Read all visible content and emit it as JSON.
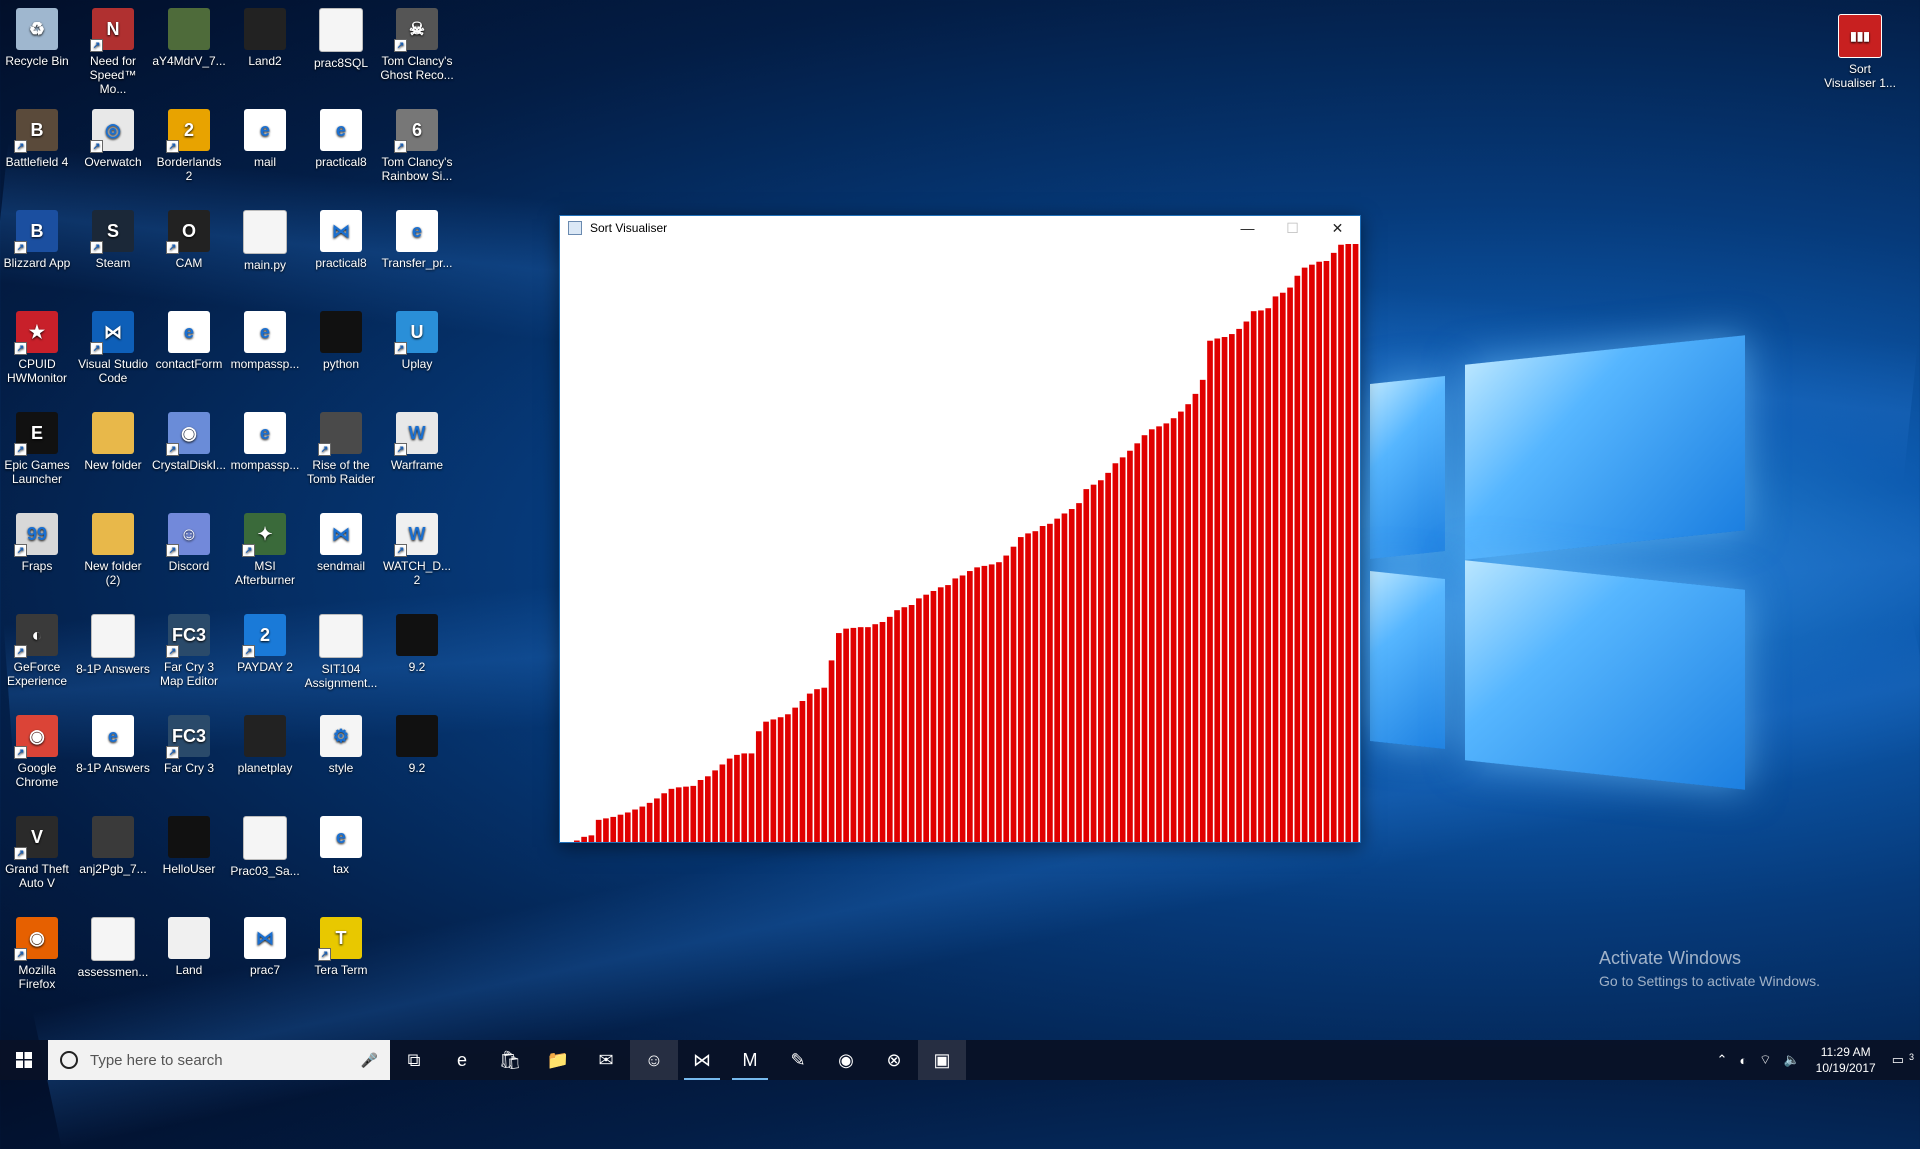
{
  "desktop": {
    "icons": [
      {
        "label": "Recycle Bin",
        "icon": "recycle-bin-icon",
        "color": "#9fb7cf",
        "glyph": "♻",
        "shortcut": false
      },
      {
        "label": "Need for Speed™ Mo...",
        "icon": "game-icon",
        "color": "#b03030",
        "glyph": "N",
        "shortcut": true
      },
      {
        "label": "aY4MdrV_7...",
        "icon": "image-icon",
        "color": "#4e6b3a",
        "glyph": "",
        "shortcut": false
      },
      {
        "label": "Land2",
        "icon": "window-icon",
        "color": "#222",
        "glyph": "",
        "shortcut": false
      },
      {
        "label": "prac8SQL",
        "icon": "file-icon",
        "color": "#f5f5f5",
        "glyph": "",
        "shortcut": false
      },
      {
        "label": "Tom Clancy's Ghost Reco...",
        "icon": "game-icon",
        "color": "#555",
        "glyph": "☠",
        "shortcut": true
      },
      {
        "label": "Battlefield 4",
        "icon": "game-icon",
        "color": "#5a4a3a",
        "glyph": "B",
        "shortcut": true
      },
      {
        "label": "Overwatch",
        "icon": "overwatch-icon",
        "color": "#e8e8e8",
        "glyph": "◎",
        "shortcut": true
      },
      {
        "label": "Borderlands 2",
        "icon": "game-icon",
        "color": "#e8a300",
        "glyph": "2",
        "shortcut": true
      },
      {
        "label": "mail",
        "icon": "edge-icon",
        "color": "#ffffff",
        "glyph": "e",
        "shortcut": false
      },
      {
        "label": "practical8",
        "icon": "edge-icon",
        "color": "#ffffff",
        "glyph": "e",
        "shortcut": false
      },
      {
        "label": "Tom Clancy's Rainbow Si...",
        "icon": "game-icon",
        "color": "#777",
        "glyph": "6",
        "shortcut": true
      },
      {
        "label": "Blizzard App",
        "icon": "blizzard-icon",
        "color": "#1b4fa0",
        "glyph": "B",
        "shortcut": true
      },
      {
        "label": "Steam",
        "icon": "steam-icon",
        "color": "#1b2838",
        "glyph": "S",
        "shortcut": true
      },
      {
        "label": "CAM",
        "icon": "cam-icon",
        "color": "#222",
        "glyph": "O",
        "shortcut": true
      },
      {
        "label": "main.py",
        "icon": "file-icon",
        "color": "#f5f5f5",
        "glyph": "",
        "shortcut": false
      },
      {
        "label": "practical8",
        "icon": "vscode-file-icon",
        "color": "#ffffff",
        "glyph": "⋈",
        "shortcut": false
      },
      {
        "label": "Transfer_pr...",
        "icon": "pdf-icon",
        "color": "#ffffff",
        "glyph": "e",
        "shortcut": false
      },
      {
        "label": "CPUID HWMonitor",
        "icon": "hwmonitor-icon",
        "color": "#c8202a",
        "glyph": "★",
        "shortcut": true
      },
      {
        "label": "Visual Studio Code",
        "icon": "vscode-icon",
        "color": "#0e5fb8",
        "glyph": "⋈",
        "shortcut": true
      },
      {
        "label": "contactForm",
        "icon": "edge-icon",
        "color": "#ffffff",
        "glyph": "e",
        "shortcut": false
      },
      {
        "label": "mompassp...",
        "icon": "pdf-icon",
        "color": "#ffffff",
        "glyph": "e",
        "shortcut": false
      },
      {
        "label": "python",
        "icon": "window-icon",
        "color": "#111",
        "glyph": "",
        "shortcut": false
      },
      {
        "label": "Uplay",
        "icon": "uplay-icon",
        "color": "#2a8fd8",
        "glyph": "U",
        "shortcut": true
      },
      {
        "label": "Epic Games Launcher",
        "icon": "epic-icon",
        "color": "#111",
        "glyph": "E",
        "shortcut": true
      },
      {
        "label": "New folder",
        "icon": "folder-icon",
        "color": "#e8b84a",
        "glyph": "",
        "shortcut": false
      },
      {
        "label": "CrystalDiskI...",
        "icon": "disk-icon",
        "color": "#6a8cd8",
        "glyph": "◉",
        "shortcut": true
      },
      {
        "label": "mompassp...",
        "icon": "pdf-icon",
        "color": "#ffffff",
        "glyph": "e",
        "shortcut": false
      },
      {
        "label": "Rise of the Tomb Raider",
        "icon": "game-icon",
        "color": "#4a4a4a",
        "glyph": "",
        "shortcut": true
      },
      {
        "label": "Warframe",
        "icon": "warframe-icon",
        "color": "#e8e8e8",
        "glyph": "W",
        "shortcut": true
      },
      {
        "label": "Fraps",
        "icon": "fraps-icon",
        "color": "#d8d8d8",
        "glyph": "99",
        "shortcut": true
      },
      {
        "label": "New folder (2)",
        "icon": "folder-icon",
        "color": "#e8b84a",
        "glyph": "",
        "shortcut": false
      },
      {
        "label": "Discord",
        "icon": "discord-icon",
        "color": "#7289da",
        "glyph": "☺",
        "shortcut": true
      },
      {
        "label": "MSI Afterburner",
        "icon": "afterburner-icon",
        "color": "#3a6a3a",
        "glyph": "✦",
        "shortcut": true
      },
      {
        "label": "sendmail",
        "icon": "vscode-file-icon",
        "color": "#ffffff",
        "glyph": "⋈",
        "shortcut": false
      },
      {
        "label": "WATCH_D... 2",
        "icon": "game-icon",
        "color": "#f0f0f0",
        "glyph": "W",
        "shortcut": true
      },
      {
        "label": "GeForce Experience",
        "icon": "nvidia-icon",
        "color": "#3a3a3a",
        "glyph": "◐",
        "shortcut": true
      },
      {
        "label": "8-1P Answers",
        "icon": "docx-icon",
        "color": "#f5f5f5",
        "glyph": "",
        "shortcut": false
      },
      {
        "label": "Far Cry 3 Map Editor",
        "icon": "fc3-icon",
        "color": "#2a4a6a",
        "glyph": "FC3",
        "shortcut": true
      },
      {
        "label": "PAYDAY 2",
        "icon": "payday-icon",
        "color": "#1a7ad8",
        "glyph": "2",
        "shortcut": true
      },
      {
        "label": "SIT104 Assignment...",
        "icon": "docx-icon",
        "color": "#f5f5f5",
        "glyph": "",
        "shortcut": false
      },
      {
        "label": "9.2",
        "icon": "window-icon",
        "color": "#111",
        "glyph": "",
        "shortcut": false
      },
      {
        "label": "Google Chrome",
        "icon": "chrome-icon",
        "color": "#db4437",
        "glyph": "◉",
        "shortcut": true
      },
      {
        "label": "8-1P Answers",
        "icon": "pdf-icon",
        "color": "#ffffff",
        "glyph": "e",
        "shortcut": false
      },
      {
        "label": "Far Cry 3",
        "icon": "fc3-icon",
        "color": "#2a4a6a",
        "glyph": "FC3",
        "shortcut": true
      },
      {
        "label": "planetplay",
        "icon": "image-icon",
        "color": "#222",
        "glyph": "",
        "shortcut": false
      },
      {
        "label": "style",
        "icon": "settings-file-icon",
        "color": "#f5f5f5",
        "glyph": "⚙",
        "shortcut": false
      },
      {
        "label": "9.2",
        "icon": "window-icon",
        "color": "#111",
        "glyph": "",
        "shortcut": false
      },
      {
        "label": "Grand Theft Auto V",
        "icon": "gta-icon",
        "color": "#2a2a2a",
        "glyph": "V",
        "shortcut": true
      },
      {
        "label": "anj2Pgb_7...",
        "icon": "image-icon",
        "color": "#3a3a3a",
        "glyph": "",
        "shortcut": false
      },
      {
        "label": "HelloUser",
        "icon": "window-icon",
        "color": "#111",
        "glyph": "",
        "shortcut": false
      },
      {
        "label": "Prac03_Sa...",
        "icon": "file-icon",
        "color": "#f5f5f5",
        "glyph": "",
        "shortcut": false
      },
      {
        "label": "tax",
        "icon": "pdf-icon",
        "color": "#ffffff",
        "glyph": "e",
        "shortcut": false
      },
      {
        "label": "",
        "icon": "",
        "color": "",
        "glyph": "",
        "shortcut": false
      },
      {
        "label": "Mozilla Firefox",
        "icon": "firefox-icon",
        "color": "#e66000",
        "glyph": "◉",
        "shortcut": true
      },
      {
        "label": "assessmen...",
        "icon": "file-icon",
        "color": "#f5f5f5",
        "glyph": "",
        "shortcut": false
      },
      {
        "label": "Land",
        "icon": "window-icon",
        "color": "#f0f0f0",
        "glyph": "",
        "shortcut": false
      },
      {
        "label": "prac7",
        "icon": "vscode-file-icon",
        "color": "#ffffff",
        "glyph": "⋈",
        "shortcut": false
      },
      {
        "label": "Tera Term",
        "icon": "teraterm-icon",
        "color": "#e8c800",
        "glyph": "T",
        "shortcut": true
      }
    ],
    "top_right_icon": {
      "label": "Sort Visualiser 1...",
      "icon": "sort-visualiser-icon",
      "color": "#c82020"
    }
  },
  "window": {
    "title": "Sort Visualiser",
    "minimize_glyph": "—",
    "maximize_glyph": "☐",
    "close_glyph": "✕",
    "bar_color": "#e00000",
    "background_color": "#ffffff"
  },
  "chart_data": {
    "type": "bar",
    "title": "",
    "values": [
      2,
      7,
      9,
      30,
      32,
      34,
      37,
      40,
      44,
      48,
      53,
      59,
      66,
      72,
      74,
      75,
      76,
      84,
      89,
      97,
      105,
      113,
      118,
      120,
      120,
      150,
      163,
      166,
      169,
      173,
      182,
      191,
      201,
      207,
      209,
      246,
      283,
      289,
      290,
      291,
      291,
      295,
      298,
      305,
      314,
      318,
      321,
      330,
      335,
      340,
      345,
      348,
      357,
      361,
      367,
      372,
      374,
      376,
      379,
      388,
      400,
      413,
      418,
      421,
      428,
      431,
      438,
      445,
      451,
      459,
      478,
      484,
      490,
      500,
      513,
      521,
      530,
      540,
      551,
      559,
      563,
      567,
      574,
      583,
      593,
      607,
      626,
      679,
      682,
      684,
      688,
      695,
      705,
      719,
      720,
      723,
      739,
      744,
      751,
      767,
      778,
      782,
      786,
      787,
      798,
      809,
      810,
      810
    ],
    "ylim": [
      0,
      810
    ]
  },
  "watermark": {
    "line1": "Activate Windows",
    "line2": "Go to Settings to activate Windows."
  },
  "taskbar": {
    "search_placeholder": "Type here to search",
    "apps": [
      {
        "name": "task-view-icon",
        "glyph": "⧉",
        "state": ""
      },
      {
        "name": "edge-icon",
        "glyph": "e",
        "state": ""
      },
      {
        "name": "store-icon",
        "glyph": "🛍",
        "state": ""
      },
      {
        "name": "file-explorer-icon",
        "glyph": "📁",
        "state": ""
      },
      {
        "name": "mail-icon",
        "glyph": "✉",
        "state": ""
      },
      {
        "name": "discord-icon",
        "glyph": "☺",
        "state": "open"
      },
      {
        "name": "vscode-icon",
        "glyph": "⋈",
        "state": "active"
      },
      {
        "name": "moai-icon",
        "glyph": "M",
        "state": "active"
      },
      {
        "name": "paint-icon",
        "glyph": "✎",
        "state": ""
      },
      {
        "name": "chrome-icon",
        "glyph": "◉",
        "state": ""
      },
      {
        "name": "xbox-icon",
        "glyph": "⊗",
        "state": ""
      },
      {
        "name": "sort-visualiser-icon",
        "glyph": "▣",
        "state": "open"
      }
    ],
    "time": "11:29 AM",
    "date": "10/19/2017",
    "notification_count": "3"
  }
}
